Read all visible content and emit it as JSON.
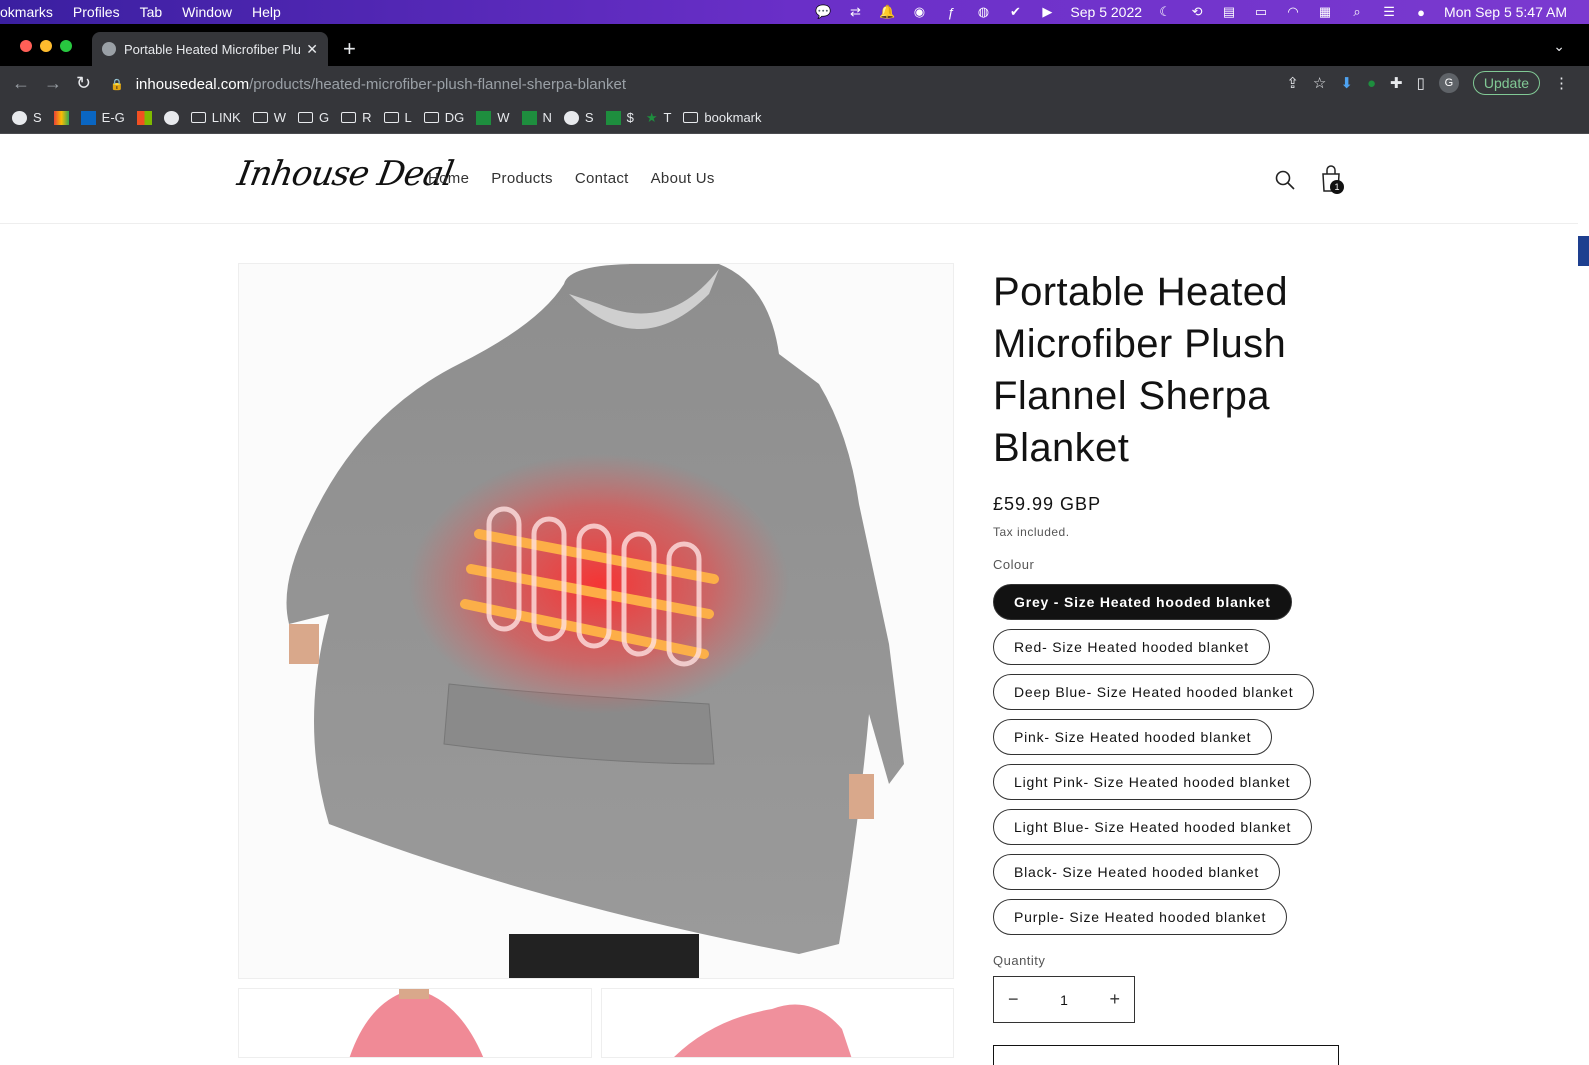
{
  "menubar": {
    "items": [
      "okmarks",
      "Profiles",
      "Tab",
      "Window",
      "Help"
    ],
    "date": "Sep 5 2022",
    "clock": "Mon Sep 5  5:47 AM"
  },
  "browser": {
    "tab_title": "Portable Heated Microfiber Plu",
    "url_host": "inhousedeal.com",
    "url_path": "/products/heated-microfiber-plush-flannel-sherpa-blanket",
    "update_label": "Update",
    "profile_initial": "G",
    "bookmarks": [
      {
        "icon": "globe-icon",
        "label": "S"
      },
      {
        "icon": "gmail-icon",
        "label": ""
      },
      {
        "icon": "outlook-icon",
        "label": "E-G"
      },
      {
        "icon": "microsoft-icon",
        "label": ""
      },
      {
        "icon": "globe-icon",
        "label": ""
      },
      {
        "icon": "folder-icon",
        "label": "LINK"
      },
      {
        "icon": "folder-icon",
        "label": "W"
      },
      {
        "icon": "folder-icon",
        "label": "G"
      },
      {
        "icon": "folder-icon",
        "label": "R"
      },
      {
        "icon": "folder-icon",
        "label": "L"
      },
      {
        "icon": "folder-icon",
        "label": "DG"
      },
      {
        "icon": "sheets-icon",
        "label": "W"
      },
      {
        "icon": "sheets-icon",
        "label": "N"
      },
      {
        "icon": "globe-icon",
        "label": "S"
      },
      {
        "icon": "sheets-icon",
        "label": "$"
      },
      {
        "icon": "star-icon",
        "label": "T"
      },
      {
        "icon": "folder-icon",
        "label": "bookmark"
      }
    ]
  },
  "site": {
    "logo": "Inhouse Deal",
    "nav": [
      "Home",
      "Products",
      "Contact",
      "About Us"
    ],
    "cart_count": "1"
  },
  "product": {
    "title": "Portable Heated Microfiber Plush Flannel Sherpa Blanket",
    "price": "£59.99 GBP",
    "tax_note": "Tax included.",
    "colour_label": "Colour",
    "options": [
      "Grey - Size Heated hooded blanket",
      "Red- Size Heated hooded blanket",
      "Deep Blue- Size Heated hooded blanket",
      "Pink- Size Heated hooded blanket",
      "Light Pink- Size Heated hooded blanket",
      "Light Blue- Size Heated hooded blanket",
      "Black- Size Heated hooded blanket",
      "Purple- Size Heated hooded blanket"
    ],
    "selected_option": "Grey - Size Heated hooded blanket",
    "quantity_label": "Quantity",
    "quantity": "1"
  }
}
